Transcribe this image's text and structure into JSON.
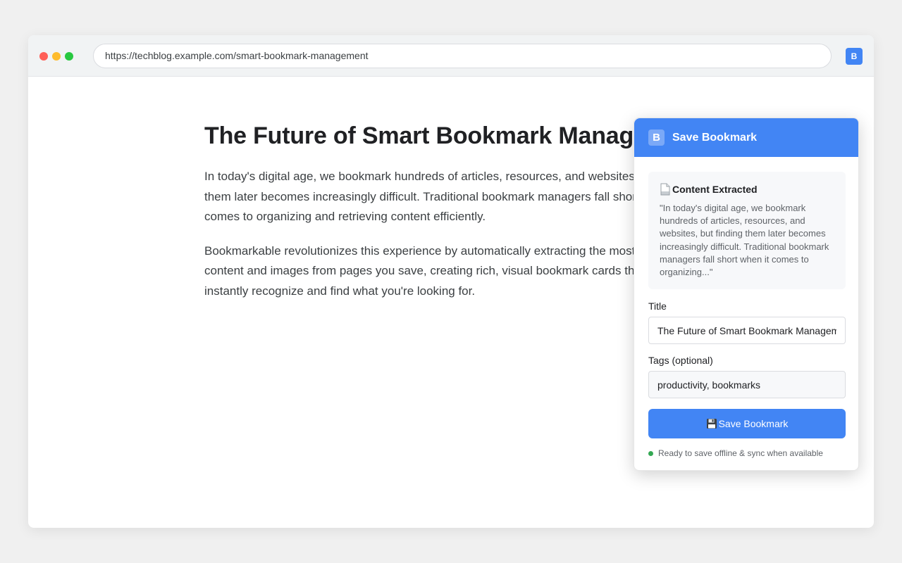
{
  "browser": {
    "url": "https://techblog.example.com/smart-bookmark-management",
    "extension_icon": "B"
  },
  "article": {
    "title": "The Future of Smart Bookmark Management",
    "paragraphs": [
      "In today's digital age, we bookmark hundreds of articles, resources, and websites, but finding them later becomes increasingly difficult. Traditional bookmark managers fall short when it comes to organizing and retrieving content efficiently.",
      "Bookmarkable revolutionizes this experience by automatically extracting the most relevant content and images from pages you save, creating rich, visual bookmark cards that help you instantly recognize and find what you're looking for."
    ]
  },
  "popup": {
    "logo": "B",
    "title": "Save Bookmark",
    "extracted": {
      "icon": "document-icon",
      "heading": "Content Extracted",
      "text": "\"In today's digital age, we bookmark hundreds of articles, resources, and websites, but finding them later becomes increasingly difficult. Traditional bookmark managers fall short when it comes to organizing...\""
    },
    "title_field": {
      "label": "Title",
      "value": "The Future of Smart Bookmark Management"
    },
    "tags_field": {
      "label": "Tags (optional)",
      "value": "productivity, bookmarks"
    },
    "save_button": {
      "icon": "floppy-disk-icon",
      "label": "Save Bookmark"
    },
    "status": {
      "text": "Ready to save offline & sync when available",
      "color": "#34a853"
    }
  },
  "colors": {
    "accent": "#4285f4",
    "status_ok": "#34a853"
  }
}
